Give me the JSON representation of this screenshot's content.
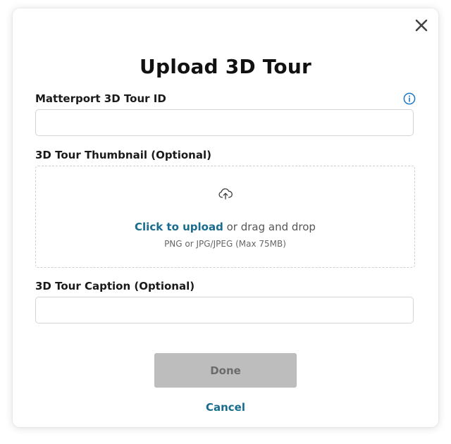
{
  "dialog": {
    "title": "Upload 3D Tour",
    "close_icon": "close-icon"
  },
  "fields": {
    "tour_id": {
      "label": "Matterport 3D Tour ID",
      "value": "",
      "placeholder": "",
      "info_icon": "info-icon"
    },
    "thumbnail": {
      "label": "3D Tour Thumbnail (Optional)",
      "upload_icon": "cloud-upload-icon",
      "click_text": "Click to upload",
      "drag_text": " or drag and drop",
      "hint": "PNG or JPG/JPEG (Max 75MB)"
    },
    "caption": {
      "label": "3D Tour Caption (Optional)",
      "value": "",
      "placeholder": ""
    }
  },
  "actions": {
    "done_label": "Done",
    "cancel_label": "Cancel"
  },
  "colors": {
    "accent": "#1a6c8e",
    "disabled_button_bg": "#bdbdbd",
    "disabled_button_text": "#6b6b6b",
    "border": "#d4d4d4",
    "info": "#1a76c2"
  }
}
